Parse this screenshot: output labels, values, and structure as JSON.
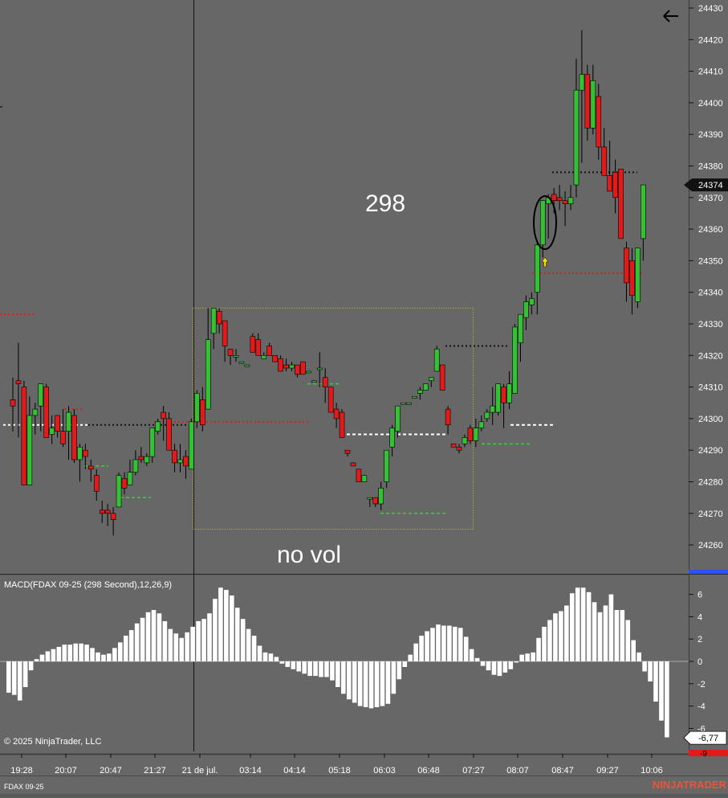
{
  "app": {
    "instrument_label": "FDAX 09-25",
    "copyright": "© 2025 NinjaTrader, LLC",
    "brand": "NINJATRADER",
    "back_icon": "arrow-left-icon"
  },
  "annotations": {
    "period_label": "298",
    "box_label": "no vol"
  },
  "colors": {
    "background": "#676767",
    "up_candle": "#34c234",
    "down_candle": "#e41a1a",
    "macd_bar": "#ffffff",
    "brand": "#e8553a",
    "price_tag_bg": "#111111",
    "box_border": "#d8c420"
  },
  "price_axis": {
    "ticks": [
      "24430",
      "24420",
      "24410",
      "24400",
      "24390",
      "24380",
      "24370",
      "24360",
      "24350",
      "24340",
      "24330",
      "24320",
      "24310",
      "24300",
      "24290",
      "24280",
      "24270",
      "24260"
    ],
    "current_price": "24374"
  },
  "macd_axis": {
    "ticks": [
      "6",
      "4",
      "2",
      "0",
      "-2",
      "-4",
      "-6"
    ],
    "current_value": "-6,77",
    "cut_label": "-9"
  },
  "time_axis": {
    "labels": [
      "19:28",
      "20:07",
      "20:47",
      "21:27",
      "21 de jul.",
      "03:14",
      "04:14",
      "05:18",
      "06:03",
      "06:48",
      "07:27",
      "08:07",
      "08:47",
      "09:27",
      "10:06"
    ]
  },
  "chart_data": [
    {
      "type": "candlestick",
      "title": "",
      "instrument": "FDAX 09-25",
      "period_seconds": 298,
      "ylim": [
        24255,
        24432
      ],
      "x_tick_labels": [
        "19:28",
        "20:07",
        "20:47",
        "21:27",
        "21 de jul.",
        "03:14",
        "04:14",
        "05:18",
        "06:03",
        "06:48",
        "07:27",
        "08:07",
        "08:47",
        "09:27",
        "10:06"
      ],
      "last_price": 24374,
      "candles": [
        {
          "o": 24306,
          "h": 24313,
          "l": 24296,
          "c": 24304
        },
        {
          "o": 24312,
          "h": 24324,
          "l": 24294,
          "c": 24311
        },
        {
          "o": 24310,
          "h": 24312,
          "l": 24279,
          "c": 24279
        },
        {
          "o": 24279,
          "h": 24307,
          "l": 24279,
          "c": 24301
        },
        {
          "o": 24301,
          "h": 24305,
          "l": 24295,
          "c": 24303
        },
        {
          "o": 24304,
          "h": 24311,
          "l": 24296,
          "c": 24311
        },
        {
          "o": 24310,
          "h": 24311,
          "l": 24294,
          "c": 24294
        },
        {
          "o": 24295,
          "h": 24301,
          "l": 24292,
          "c": 24297
        },
        {
          "o": 24301,
          "h": 24301,
          "l": 24294,
          "c": 24296
        },
        {
          "o": 24296,
          "h": 24303,
          "l": 24291,
          "c": 24292
        },
        {
          "o": 24296,
          "h": 24304,
          "l": 24287,
          "c": 24302
        },
        {
          "o": 24301,
          "h": 24303,
          "l": 24286,
          "c": 24287
        },
        {
          "o": 24287,
          "h": 24292,
          "l": 24280,
          "c": 24291
        },
        {
          "o": 24290,
          "h": 24292,
          "l": 24284,
          "c": 24288
        },
        {
          "o": 24285,
          "h": 24287,
          "l": 24280,
          "c": 24284
        },
        {
          "o": 24282,
          "h": 24284,
          "l": 24274,
          "c": 24277
        },
        {
          "o": 24271,
          "h": 24274,
          "l": 24267,
          "c": 24270
        },
        {
          "o": 24271,
          "h": 24273,
          "l": 24266,
          "c": 24270
        },
        {
          "o": 24270,
          "h": 24272,
          "l": 24263,
          "c": 24268
        },
        {
          "o": 24272,
          "h": 24283,
          "l": 24272,
          "c": 24282
        },
        {
          "o": 24281,
          "h": 24283,
          "l": 24276,
          "c": 24278
        },
        {
          "o": 24279,
          "h": 24287,
          "l": 24279,
          "c": 24283
        },
        {
          "o": 24283,
          "h": 24290,
          "l": 24282,
          "c": 24287
        },
        {
          "o": 24288,
          "h": 24291,
          "l": 24286,
          "c": 24287
        },
        {
          "o": 24286,
          "h": 24289,
          "l": 24285,
          "c": 24288
        },
        {
          "o": 24288,
          "h": 24296,
          "l": 24286,
          "c": 24297
        },
        {
          "o": 24296,
          "h": 24300,
          "l": 24295,
          "c": 24299
        },
        {
          "o": 24302,
          "h": 24304,
          "l": 24293,
          "c": 24300
        },
        {
          "o": 24300,
          "h": 24302,
          "l": 24292,
          "c": 24290
        },
        {
          "o": 24290,
          "h": 24292,
          "l": 24283,
          "c": 24286
        },
        {
          "o": 24286,
          "h": 24292,
          "l": 24283,
          "c": 24287
        },
        {
          "o": 24288,
          "h": 24290,
          "l": 24281,
          "c": 24285
        },
        {
          "o": 24284,
          "h": 24300,
          "l": 24284,
          "c": 24299
        },
        {
          "o": 24299,
          "h": 24309,
          "l": 24297,
          "c": 24308
        },
        {
          "o": 24306,
          "h": 24310,
          "l": 24296,
          "c": 24298
        },
        {
          "o": 24303,
          "h": 24335,
          "l": 24304,
          "c": 24325
        },
        {
          "o": 24327,
          "h": 24334,
          "l": 24322,
          "c": 24335
        },
        {
          "o": 24334,
          "h": 24335,
          "l": 24327,
          "c": 24330
        },
        {
          "o": 24331,
          "h": 24331,
          "l": 24318,
          "c": 24323
        },
        {
          "o": 24322,
          "h": 24322,
          "l": 24317,
          "c": 24320
        },
        {
          "o": 24320,
          "h": 24322,
          "l": 24318,
          "c": 24320
        },
        {
          "o": 24318,
          "h": 24318,
          "l": 24318,
          "c": 24318
        },
        {
          "o": 24317,
          "h": 24317,
          "l": 24317,
          "c": 24317
        },
        {
          "o": 24326,
          "h": 24327,
          "l": 24321,
          "c": 24321
        },
        {
          "o": 24325,
          "h": 24327,
          "l": 24320,
          "c": 24320
        },
        {
          "o": 24319,
          "h": 24321,
          "l": 24319,
          "c": 24320
        },
        {
          "o": 24323,
          "h": 24324,
          "l": 24320,
          "c": 24320
        },
        {
          "o": 24320,
          "h": 24320,
          "l": 24318,
          "c": 24318
        },
        {
          "o": 24319,
          "h": 24320,
          "l": 24315,
          "c": 24315
        },
        {
          "o": 24317,
          "h": 24319,
          "l": 24315,
          "c": 24316
        },
        {
          "o": 24316,
          "h": 24318,
          "l": 24315,
          "c": 24317
        },
        {
          "o": 24317,
          "h": 24317,
          "l": 24313,
          "c": 24314
        },
        {
          "o": 24318,
          "h": 24318,
          "l": 24314,
          "c": 24314
        },
        {
          "o": 24315,
          "h": 24315,
          "l": 24315,
          "c": 24315
        },
        {
          "o": 24312,
          "h": 24312,
          "l": 24312,
          "c": 24312
        },
        {
          "o": 24316,
          "h": 24321,
          "l": 24310,
          "c": 24316
        },
        {
          "o": 24313,
          "h": 24316,
          "l": 24305,
          "c": 24310
        },
        {
          "o": 24310,
          "h": 24310,
          "l": 24302,
          "c": 24302
        },
        {
          "o": 24303,
          "h": 24305,
          "l": 24297,
          "c": 24300
        },
        {
          "o": 24302,
          "h": 24303,
          "l": 24294,
          "c": 24294
        },
        {
          "o": 24290,
          "h": 24290,
          "l": 24288,
          "c": 24289
        },
        {
          "o": 24286,
          "h": 24286,
          "l": 24285,
          "c": 24285
        },
        {
          "o": 24284,
          "h": 24284,
          "l": 24280,
          "c": 24280
        },
        {
          "o": 24280,
          "h": 24282,
          "l": 24280,
          "c": 24282
        },
        {
          "o": 24275,
          "h": 24275,
          "l": 24272,
          "c": 24275
        },
        {
          "o": 24275,
          "h": 24275,
          "l": 24272,
          "c": 24273
        },
        {
          "o": 24273,
          "h": 24280,
          "l": 24271,
          "c": 24278
        },
        {
          "o": 24280,
          "h": 24290,
          "l": 24278,
          "c": 24290
        },
        {
          "o": 24291,
          "h": 24298,
          "l": 24288,
          "c": 24297
        },
        {
          "o": 24296,
          "h": 24304,
          "l": 24294,
          "c": 24304
        },
        {
          "o": 24305,
          "h": 24305,
          "l": 24305,
          "c": 24305
        },
        {
          "o": 24305,
          "h": 24305,
          "l": 24305,
          "c": 24305
        },
        {
          "o": 24307,
          "h": 24307,
          "l": 24307,
          "c": 24307
        },
        {
          "o": 24308,
          "h": 24310,
          "l": 24306,
          "c": 24309
        },
        {
          "o": 24309,
          "h": 24311,
          "l": 24309,
          "c": 24311
        },
        {
          "o": 24312,
          "h": 24313,
          "l": 24310,
          "c": 24313
        },
        {
          "o": 24315,
          "h": 24323,
          "l": 24315,
          "c": 24322
        },
        {
          "o": 24317,
          "h": 24317,
          "l": 24309,
          "c": 24309
        },
        {
          "o": 24303,
          "h": 24304,
          "l": 24295,
          "c": 24298
        },
        {
          "o": 24292,
          "h": 24292,
          "l": 24291,
          "c": 24291
        },
        {
          "o": 24291,
          "h": 24292,
          "l": 24289,
          "c": 24290
        },
        {
          "o": 24292,
          "h": 24295,
          "l": 24291,
          "c": 24294
        },
        {
          "o": 24297,
          "h": 24298,
          "l": 24292,
          "c": 24293
        },
        {
          "o": 24293,
          "h": 24300,
          "l": 24291,
          "c": 24297
        },
        {
          "o": 24297,
          "h": 24301,
          "l": 24296,
          "c": 24299
        },
        {
          "o": 24300,
          "h": 24303,
          "l": 24299,
          "c": 24302
        },
        {
          "o": 24302,
          "h": 24310,
          "l": 24298,
          "c": 24304
        },
        {
          "o": 24302,
          "h": 24311,
          "l": 24301,
          "c": 24311
        },
        {
          "o": 24310,
          "h": 24311,
          "l": 24297,
          "c": 24305
        },
        {
          "o": 24305,
          "h": 24315,
          "l": 24303,
          "c": 24311
        },
        {
          "o": 24308,
          "h": 24330,
          "l": 24308,
          "c": 24329
        },
        {
          "o": 24324,
          "h": 24333,
          "l": 24318,
          "c": 24333
        },
        {
          "o": 24332,
          "h": 24339,
          "l": 24328,
          "c": 24337
        },
        {
          "o": 24336,
          "h": 24340,
          "l": 24333,
          "c": 24338
        },
        {
          "o": 24340,
          "h": 24356,
          "l": 24333,
          "c": 24355
        },
        {
          "o": 24355,
          "h": 24368,
          "l": 24351,
          "c": 24369
        },
        {
          "o": 24368,
          "h": 24371,
          "l": 24357,
          "c": 24370
        },
        {
          "o": 24371,
          "h": 24373,
          "l": 24365,
          "c": 24369
        },
        {
          "o": 24370,
          "h": 24374,
          "l": 24366,
          "c": 24369
        },
        {
          "o": 24369,
          "h": 24372,
          "l": 24361,
          "c": 24368
        },
        {
          "o": 24368,
          "h": 24374,
          "l": 24366,
          "c": 24370
        },
        {
          "o": 24374,
          "h": 24414,
          "l": 24370,
          "c": 24404
        },
        {
          "o": 24404,
          "h": 24423,
          "l": 24381,
          "c": 24409
        },
        {
          "o": 24409,
          "h": 24412,
          "l": 24388,
          "c": 24392
        },
        {
          "o": 24392,
          "h": 24412,
          "l": 24390,
          "c": 24407
        },
        {
          "o": 24402,
          "h": 24406,
          "l": 24382,
          "c": 24386
        },
        {
          "o": 24386,
          "h": 24392,
          "l": 24377,
          "c": 24377
        },
        {
          "o": 24377,
          "h": 24388,
          "l": 24372,
          "c": 24372
        },
        {
          "o": 24378,
          "h": 24382,
          "l": 24365,
          "c": 24370
        },
        {
          "o": 24379,
          "h": 24378,
          "l": 24357,
          "c": 24357
        },
        {
          "o": 24354,
          "h": 24356,
          "l": 24337,
          "c": 24343
        },
        {
          "o": 24350,
          "h": 24354,
          "l": 24333,
          "c": 24339
        },
        {
          "o": 24337,
          "h": 24354,
          "l": 24335,
          "c": 24354
        },
        {
          "o": 24357,
          "h": 24358,
          "l": 24350,
          "c": 24374
        }
      ],
      "levels": [
        {
          "price": 24298,
          "style": "dotted-white"
        },
        {
          "price": 24298,
          "style": "dotted-black"
        },
        {
          "price": 24303,
          "style": "dotted-red"
        },
        {
          "price": 24299,
          "style": "dotted-red"
        },
        {
          "price": 24346,
          "style": "dotted-red"
        },
        {
          "price": 24333,
          "style": "dotted-red"
        },
        {
          "price": 24285,
          "style": "dashed-green"
        },
        {
          "price": 24275,
          "style": "dashed-green"
        },
        {
          "price": 24311,
          "style": "dashed-green"
        },
        {
          "price": 24270,
          "style": "dashed-green"
        },
        {
          "price": 24292,
          "style": "dashed-green"
        },
        {
          "price": 24295,
          "style": "dashed-white"
        },
        {
          "price": 24298,
          "style": "dashed-white"
        },
        {
          "price": 24323,
          "style": "dotted-black"
        },
        {
          "price": 24378,
          "style": "dotted-black"
        }
      ],
      "box": {
        "price_high": 24335,
        "price_low": 24265,
        "label": "no vol"
      }
    },
    {
      "type": "bar",
      "title": "MACD(FDAX 09-25 (298 Second),12,26,9)",
      "ylim": [
        -9,
        7
      ],
      "last_value": -6.77,
      "values": [
        -2.8,
        -3.0,
        -3.5,
        -2.3,
        -0.8,
        0.2,
        0.6,
        0.9,
        1.1,
        1.3,
        1.5,
        1.5,
        1.6,
        1.6,
        1.5,
        1.2,
        0.8,
        0.6,
        0.7,
        1.2,
        1.7,
        2.3,
        2.8,
        3.4,
        3.9,
        4.4,
        4.6,
        4.3,
        3.6,
        2.9,
        2.5,
        2.1,
        2.6,
        3.1,
        3.6,
        3.8,
        4.3,
        5.6,
        6.6,
        6.4,
        5.9,
        4.8,
        3.8,
        2.9,
        2.3,
        1.4,
        0.8,
        0.7,
        0.4,
        -0.2,
        -0.5,
        -0.7,
        -0.9,
        -1.1,
        -1.3,
        -1.3,
        -1.4,
        -1.4,
        -1.7,
        -2.3,
        -2.9,
        -3.4,
        -3.7,
        -4.0,
        -4.1,
        -4.2,
        -4.1,
        -4.0,
        -3.8,
        -2.9,
        -1.6,
        -0.5,
        0.6,
        1.6,
        2.3,
        2.7,
        3.0,
        3.3,
        3.2,
        3.2,
        3.1,
        3.0,
        2.2,
        1.1,
        0.3,
        -0.4,
        -0.8,
        -1.2,
        -1.3,
        -1.0,
        -0.7,
        -0.1,
        0.6,
        0.7,
        0.8,
        2.1,
        3.1,
        3.7,
        4.3,
        4.5,
        5.0,
        6.1,
        6.6,
        6.6,
        6.2,
        5.3,
        4.4,
        5.0,
        6.0,
        4.6,
        4.6,
        3.7,
        1.9,
        0.8,
        -0.9,
        -1.8,
        -3.6,
        -5.3,
        -6.8
      ]
    }
  ]
}
